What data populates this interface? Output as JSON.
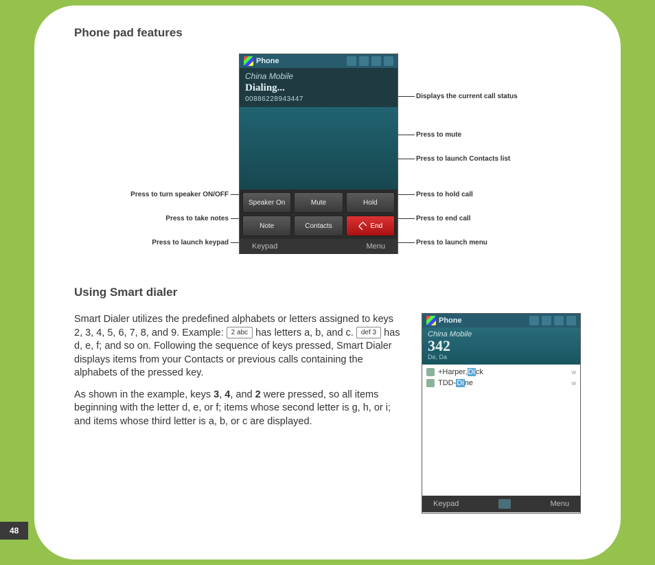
{
  "page_number": "48",
  "section1_title": "Phone pad features",
  "phone1": {
    "title": "Phone",
    "carrier": "China Mobile",
    "status": "Dialing...",
    "number": "00886228943447",
    "buttons": {
      "speaker": "Speaker On",
      "mute": "Mute",
      "hold": "Hold",
      "note": "Note",
      "contacts": "Contacts",
      "end": "End"
    },
    "softkeys": {
      "left": "Keypad",
      "right": "Menu"
    }
  },
  "callouts": {
    "status": "Displays the current call status",
    "mute": "Press to mute",
    "contacts": "Press to launch Contacts list",
    "hold": "Press to hold call",
    "end": "Press to end call",
    "menu": "Press to launch menu",
    "speaker": "Press to turn speaker ON/OFF",
    "note": "Press to take notes",
    "keypad": "Press to launch keypad"
  },
  "section2_title": "Using Smart dialer",
  "para1_a": "Smart Dialer utilizes the predefined alphabets or letters assigned to keys 2, 3, 4, 5, 6, 7, 8, and 9. Example: ",
  "key2": "2 abc",
  "para1_b": " has letters a, b, and c. ",
  "key3": "def 3",
  "para1_c": " has d, e, f; and so on. Following the sequence of keys pressed, Smart Dialer displays items from your Contacts or previous calls containing the alphabets of the pressed key.",
  "para2_a": "As shown in the example, keys ",
  "b1": "3",
  "comma1": ", ",
  "b2": "4",
  "comma2": ", and ",
  "b3": "2",
  "para2_b": " were pressed, so all items beginning with the letter d, e, or f; items whose second letter is g, h, or i; and items whose third letter is a, b, or c are displayed.",
  "phone2": {
    "title": "Phone",
    "carrier": "China Mobile",
    "digits": "342",
    "sub": "De, Da",
    "rows": [
      {
        "pre": "+Harper, ",
        "hl": "Di",
        "post": "ck",
        "rt": "w"
      },
      {
        "pre": "TDD-",
        "hl": "Di",
        "post": "ne",
        "rt": "w"
      }
    ],
    "softkeys": {
      "left": "Keypad",
      "right": "Menu"
    }
  }
}
